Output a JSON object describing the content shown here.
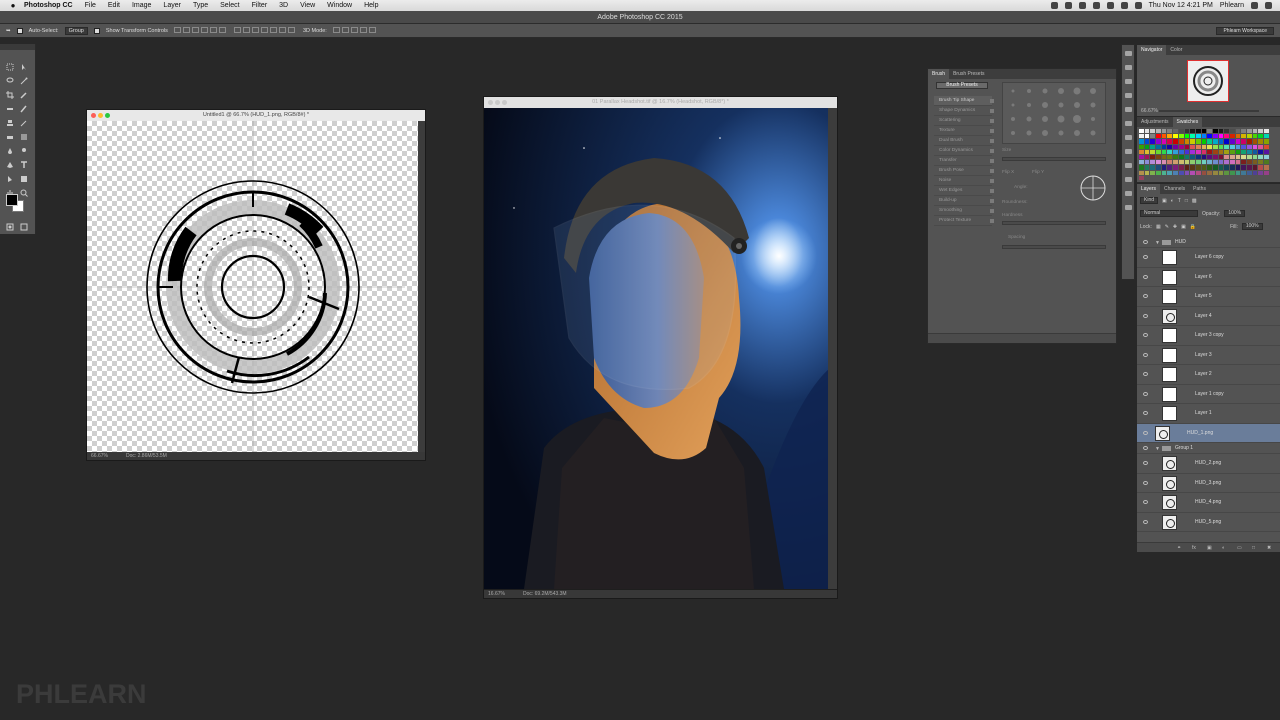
{
  "menubar": {
    "apple": "",
    "app_name": "Photoshop CC",
    "items": [
      "File",
      "Edit",
      "Image",
      "Layer",
      "Type",
      "Select",
      "Filter",
      "3D",
      "View",
      "Window",
      "Help"
    ],
    "clock": "Thu Nov 12  4:21 PM",
    "user": "Phlearn"
  },
  "titlebar": {
    "title": "Adobe Photoshop CC 2015"
  },
  "options": {
    "auto_select_label": "Auto-Select:",
    "auto_select_value": "Group",
    "transform_controls_label": "Show Transform Controls",
    "mode_3d_label": "3D Mode:",
    "workspace": "Phlearn Workspace"
  },
  "doc1": {
    "title": "Untitled1 @ 66.7% (HUD_1.png, RGB/8#) *",
    "zoom": "66.67%",
    "doc_size": "Doc: 2.86M/53.5M"
  },
  "doc2": {
    "title": "01 Parallax Headshot.tif @ 16.7% (Headshot, RGB/8*) *",
    "zoom": "16.67%",
    "doc_size": "Doc: 69.2M/543.3M"
  },
  "brush_panel": {
    "tabs": [
      "Brush",
      "Brush Presets"
    ],
    "preset_button": "Brush Presets",
    "options": [
      "Brush Tip Shape",
      "Shape Dynamics",
      "Scattering",
      "Texture",
      "Dual Brush",
      "Color Dynamics",
      "Transfer",
      "Brush Pose",
      "Noise",
      "Wet Edges",
      "Build-up",
      "Smoothing",
      "Protect Texture"
    ],
    "size_label": "Size",
    "flip_x": "Flip X",
    "flip_y": "Flip Y",
    "angle_label": "Angle:",
    "roundness_label": "Roundness:",
    "hardness_label": "Hardness",
    "spacing_label": "Spacing"
  },
  "navigator": {
    "tabs": [
      "Navigator",
      "Color"
    ],
    "zoom": "66.67%"
  },
  "swatches": {
    "tabs": [
      "Adjustments",
      "Swatches"
    ]
  },
  "layers_panel": {
    "tabs": [
      "Layers",
      "Channels",
      "Paths"
    ],
    "filter_kind": "Kind",
    "blend_mode": "Normal",
    "opacity_label": "Opacity:",
    "opacity_value": "100%",
    "lock_label": "Lock:",
    "fill_label": "Fill:",
    "fill_value": "100%",
    "layers": [
      {
        "name": "HUD",
        "kind": "group"
      },
      {
        "name": "Layer 6 copy",
        "kind": "layer"
      },
      {
        "name": "Layer 6",
        "kind": "layer"
      },
      {
        "name": "Layer 5",
        "kind": "layer"
      },
      {
        "name": "Layer 4",
        "kind": "layer"
      },
      {
        "name": "Layer 3 copy",
        "kind": "layer"
      },
      {
        "name": "Layer 3",
        "kind": "layer"
      },
      {
        "name": "Layer 2",
        "kind": "layer"
      },
      {
        "name": "Layer 1 copy",
        "kind": "layer"
      },
      {
        "name": "Layer 1",
        "kind": "layer"
      },
      {
        "name": "HUD_1.png",
        "kind": "layer",
        "selected": true
      },
      {
        "name": "Group 1",
        "kind": "group"
      },
      {
        "name": "HUD_2.png",
        "kind": "layer"
      },
      {
        "name": "HUD_3.png",
        "kind": "layer"
      },
      {
        "name": "HUD_4.png",
        "kind": "layer"
      },
      {
        "name": "HUD_5.png",
        "kind": "layer"
      }
    ]
  },
  "watermark": "PHLEARN",
  "colors": {
    "ui_bg": "#282828",
    "panel_bg": "#535353",
    "selected_layer": "#6a7d9a",
    "navigator_frame": "#e03030"
  }
}
